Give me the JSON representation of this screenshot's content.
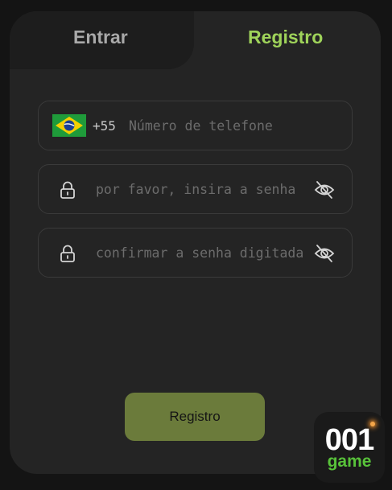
{
  "tabs": {
    "login_label": "Entrar",
    "register_label": "Registro"
  },
  "phone": {
    "dial_code": "+55",
    "placeholder": "Número de telefone",
    "flag_icon": "brazil-flag-icon"
  },
  "password": {
    "placeholder": "por favor, insira a senha",
    "lock_icon": "lock-icon",
    "toggle_icon": "eye-off-icon"
  },
  "confirm_password": {
    "placeholder": "confirmar a senha digitada",
    "lock_icon": "lock-icon",
    "toggle_icon": "eye-off-icon"
  },
  "submit": {
    "label": "Registro"
  },
  "brand": {
    "logo_number": "001",
    "logo_word": "game"
  },
  "colors": {
    "accent": "#9fd35a",
    "button": "#6b7b3b",
    "card": "#242424",
    "background": "#141414"
  }
}
